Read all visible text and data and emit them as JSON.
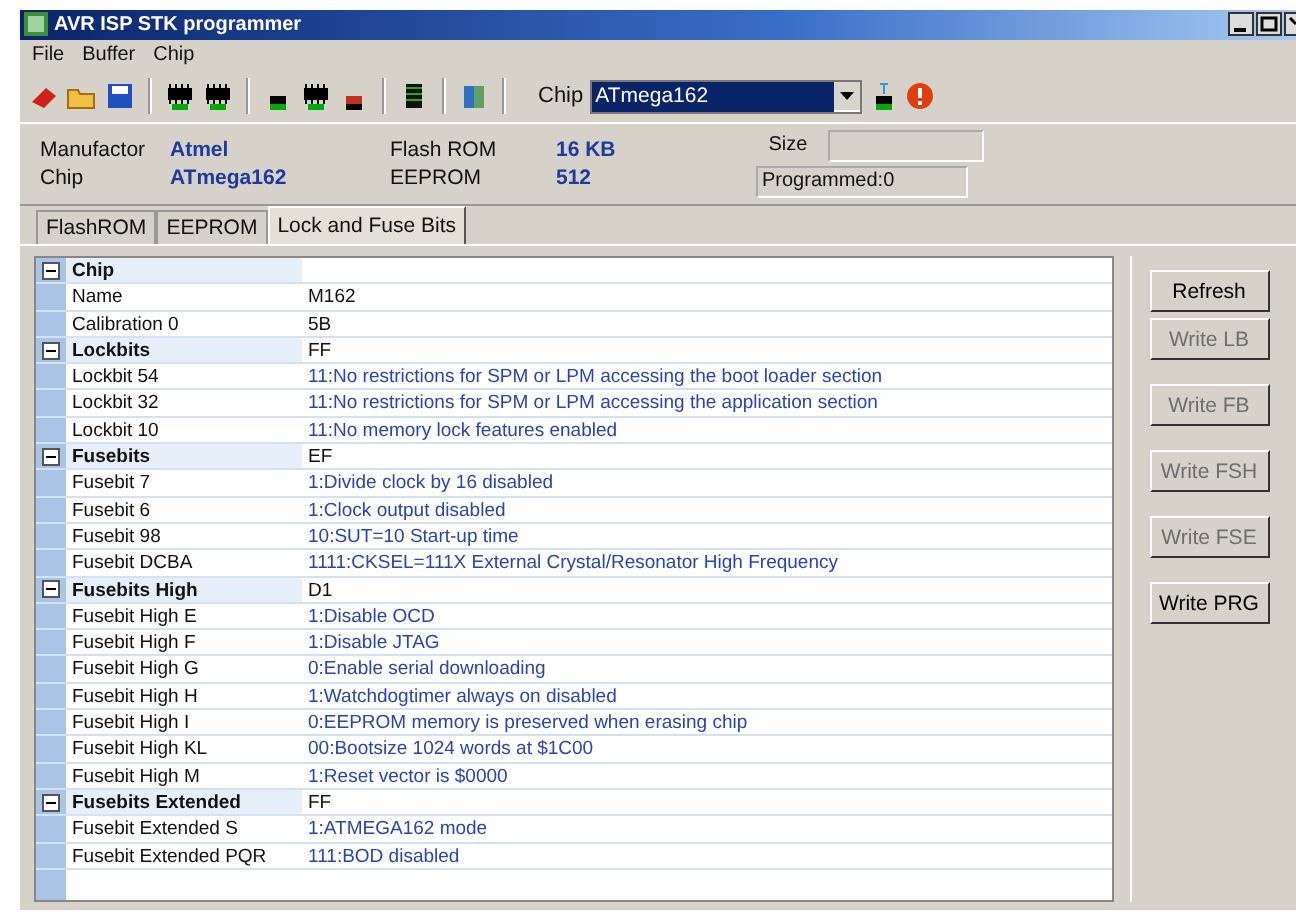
{
  "window": {
    "title": "AVR ISP STK programmer"
  },
  "menu": [
    "File",
    "Buffer",
    "Chip"
  ],
  "toolbar": {
    "chip_label": "Chip",
    "chip_value": "ATmega162"
  },
  "info": {
    "manufacturer_label": "Manufactor",
    "manufacturer": "Atmel",
    "chip_label": "Chip",
    "chip": "ATmega162",
    "flash_label": "Flash ROM",
    "flash": "16 KB",
    "eeprom_label": "EEPROM",
    "eeprom": "512",
    "size_label": "Size",
    "programmed": "Programmed:0"
  },
  "tabs": [
    {
      "label": "FlashROM",
      "selected": false
    },
    {
      "label": "EEPROM",
      "selected": false
    },
    {
      "label": "Lock and Fuse Bits",
      "selected": true
    }
  ],
  "groups": [
    {
      "name": "Chip",
      "expanded": true,
      "rows": [
        {
          "name": "Name",
          "value": "M162",
          "kind": "plain"
        },
        {
          "name": "Calibration 0",
          "value": "5B",
          "kind": "plain"
        }
      ]
    },
    {
      "name": "Lockbits",
      "value": "FF",
      "expanded": true,
      "rows": [
        {
          "name": "Lockbit 54",
          "value": "11:No restrictions for SPM or LPM accessing the boot loader section",
          "kind": "description"
        },
        {
          "name": "Lockbit 32",
          "value": "11:No restrictions for SPM or LPM accessing the application section",
          "kind": "description"
        },
        {
          "name": "Lockbit 10",
          "value": "11:No memory lock features enabled",
          "kind": "description"
        }
      ]
    },
    {
      "name": "Fusebits",
      "value": "EF",
      "expanded": true,
      "rows": [
        {
          "name": "Fusebit 7",
          "value": "1:Divide clock by 16 disabled",
          "kind": "description"
        },
        {
          "name": "Fusebit 6",
          "value": "1:Clock output disabled",
          "kind": "description"
        },
        {
          "name": "Fusebit 98",
          "value": "10:SUT=10 Start-up time",
          "kind": "description"
        },
        {
          "name": "Fusebit DCBA",
          "value": "1111:CKSEL=111X External Crystal/Resonator High Frequency",
          "kind": "description"
        }
      ]
    },
    {
      "name": "Fusebits High",
      "value": "D1",
      "expanded": true,
      "rows": [
        {
          "name": "Fusebit High E",
          "value": "1:Disable OCD",
          "kind": "description"
        },
        {
          "name": "Fusebit High F",
          "value": "1:Disable JTAG",
          "kind": "description"
        },
        {
          "name": "Fusebit High G",
          "value": "0:Enable serial downloading",
          "kind": "description"
        },
        {
          "name": "Fusebit High H",
          "value": "1:Watchdogtimer always on disabled",
          "kind": "description"
        },
        {
          "name": "Fusebit High I",
          "value": "0:EEPROM memory is preserved when erasing chip",
          "kind": "description"
        },
        {
          "name": "Fusebit High KL",
          "value": "00:Bootsize 1024 words at $1C00",
          "kind": "description"
        },
        {
          "name": "Fusebit High M",
          "value": "1:Reset vector is $0000",
          "kind": "description"
        }
      ]
    },
    {
      "name": "Fusebits Extended",
      "value": "FF",
      "expanded": true,
      "rows": [
        {
          "name": "Fusebit Extended S",
          "value": "1:ATMEGA162 mode",
          "kind": "description"
        },
        {
          "name": "Fusebit Extended PQR",
          "value": "111:BOD disabled",
          "kind": "description"
        }
      ]
    }
  ],
  "buttons": [
    {
      "label": "Refresh",
      "disabled": false
    },
    {
      "label": "Write LB",
      "disabled": true
    },
    {
      "label": "Write FB",
      "disabled": true
    },
    {
      "label": "Write FSH",
      "disabled": true
    },
    {
      "label": "Write FSE",
      "disabled": true
    },
    {
      "label": "Write PRG",
      "disabled": false
    }
  ]
}
